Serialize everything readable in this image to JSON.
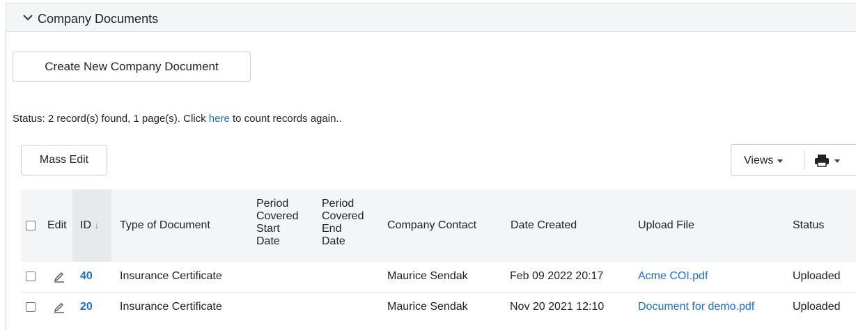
{
  "panel": {
    "title": "Company Documents"
  },
  "toolbar": {
    "create_label": "Create New Company Document",
    "mass_edit_label": "Mass Edit",
    "views_label": "Views"
  },
  "status": {
    "prefix": "Status: 2 record(s) found, 1 page(s). Click ",
    "link": "here",
    "suffix": " to count records again.."
  },
  "table": {
    "headers": {
      "edit": "Edit",
      "id": "ID",
      "sort_arrow": "↓",
      "type": "Type of Document",
      "period_start": [
        "Period",
        "Covered",
        "Start",
        "Date"
      ],
      "period_end": [
        "Period",
        "Covered",
        "End",
        "Date"
      ],
      "contact": "Company Contact",
      "date_created": "Date Created",
      "upload_file": "Upload File",
      "status": "Status"
    },
    "rows": [
      {
        "id": "40",
        "type": "Insurance Certificate",
        "contact": "Maurice Sendak",
        "date_created": "Feb 09 2022 20:17",
        "file": "Acme COI.pdf",
        "status": "Uploaded"
      },
      {
        "id": "20",
        "type": "Insurance Certificate",
        "contact": "Maurice Sendak",
        "date_created": "Nov 20 2021 12:10",
        "file": "Document for demo.pdf",
        "status": "Uploaded"
      }
    ]
  },
  "colors": {
    "link": "#1a6fc9",
    "header_bg": "#f4f5f7",
    "border": "#c9ccd1"
  }
}
